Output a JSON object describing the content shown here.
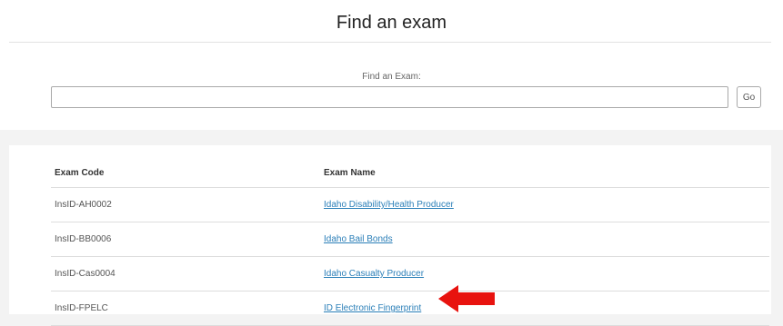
{
  "header": {
    "title": "Find an exam"
  },
  "search": {
    "label": "Find an Exam:",
    "value": "",
    "placeholder": "",
    "go_label": "Go"
  },
  "results": {
    "columns": [
      "Exam Code",
      "Exam Name"
    ],
    "rows": [
      {
        "code": "InsID-AH0002",
        "name": "Idaho Disability/Health Producer"
      },
      {
        "code": "InsID-BB0006",
        "name": "Idaho Bail Bonds"
      },
      {
        "code": "InsID-Cas0004",
        "name": "Idaho Casualty Producer"
      },
      {
        "code": "InsID-FPELC",
        "name": "ID Electronic Fingerprint"
      }
    ]
  },
  "annotation": {
    "arrow_color": "#e8130f",
    "icon": "left-arrow-icon"
  }
}
